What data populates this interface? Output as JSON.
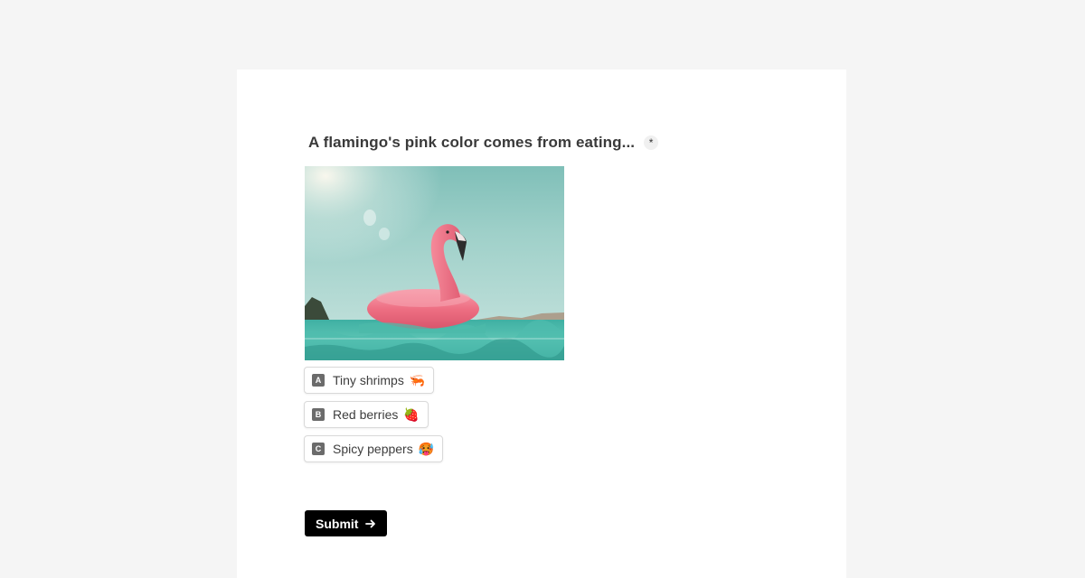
{
  "question": {
    "text": "A flamingo's pink color comes from eating...",
    "required_mark": "*"
  },
  "image": {
    "description_icon": "flamingo-pool-float-photo"
  },
  "choices": [
    {
      "key": "A",
      "label": "Tiny shrimps",
      "emoji": "🦐"
    },
    {
      "key": "B",
      "label": "Red berries",
      "emoji": "🍓"
    },
    {
      "key": "C",
      "label": "Spicy peppers",
      "emoji": "🥵"
    }
  ],
  "submit": {
    "label": "Submit",
    "icon": "arrow-right-icon"
  },
  "colors": {
    "background": "#f5f5f5",
    "card": "#ffffff",
    "button": "#000000",
    "key_badge": "#6b6b6b"
  }
}
